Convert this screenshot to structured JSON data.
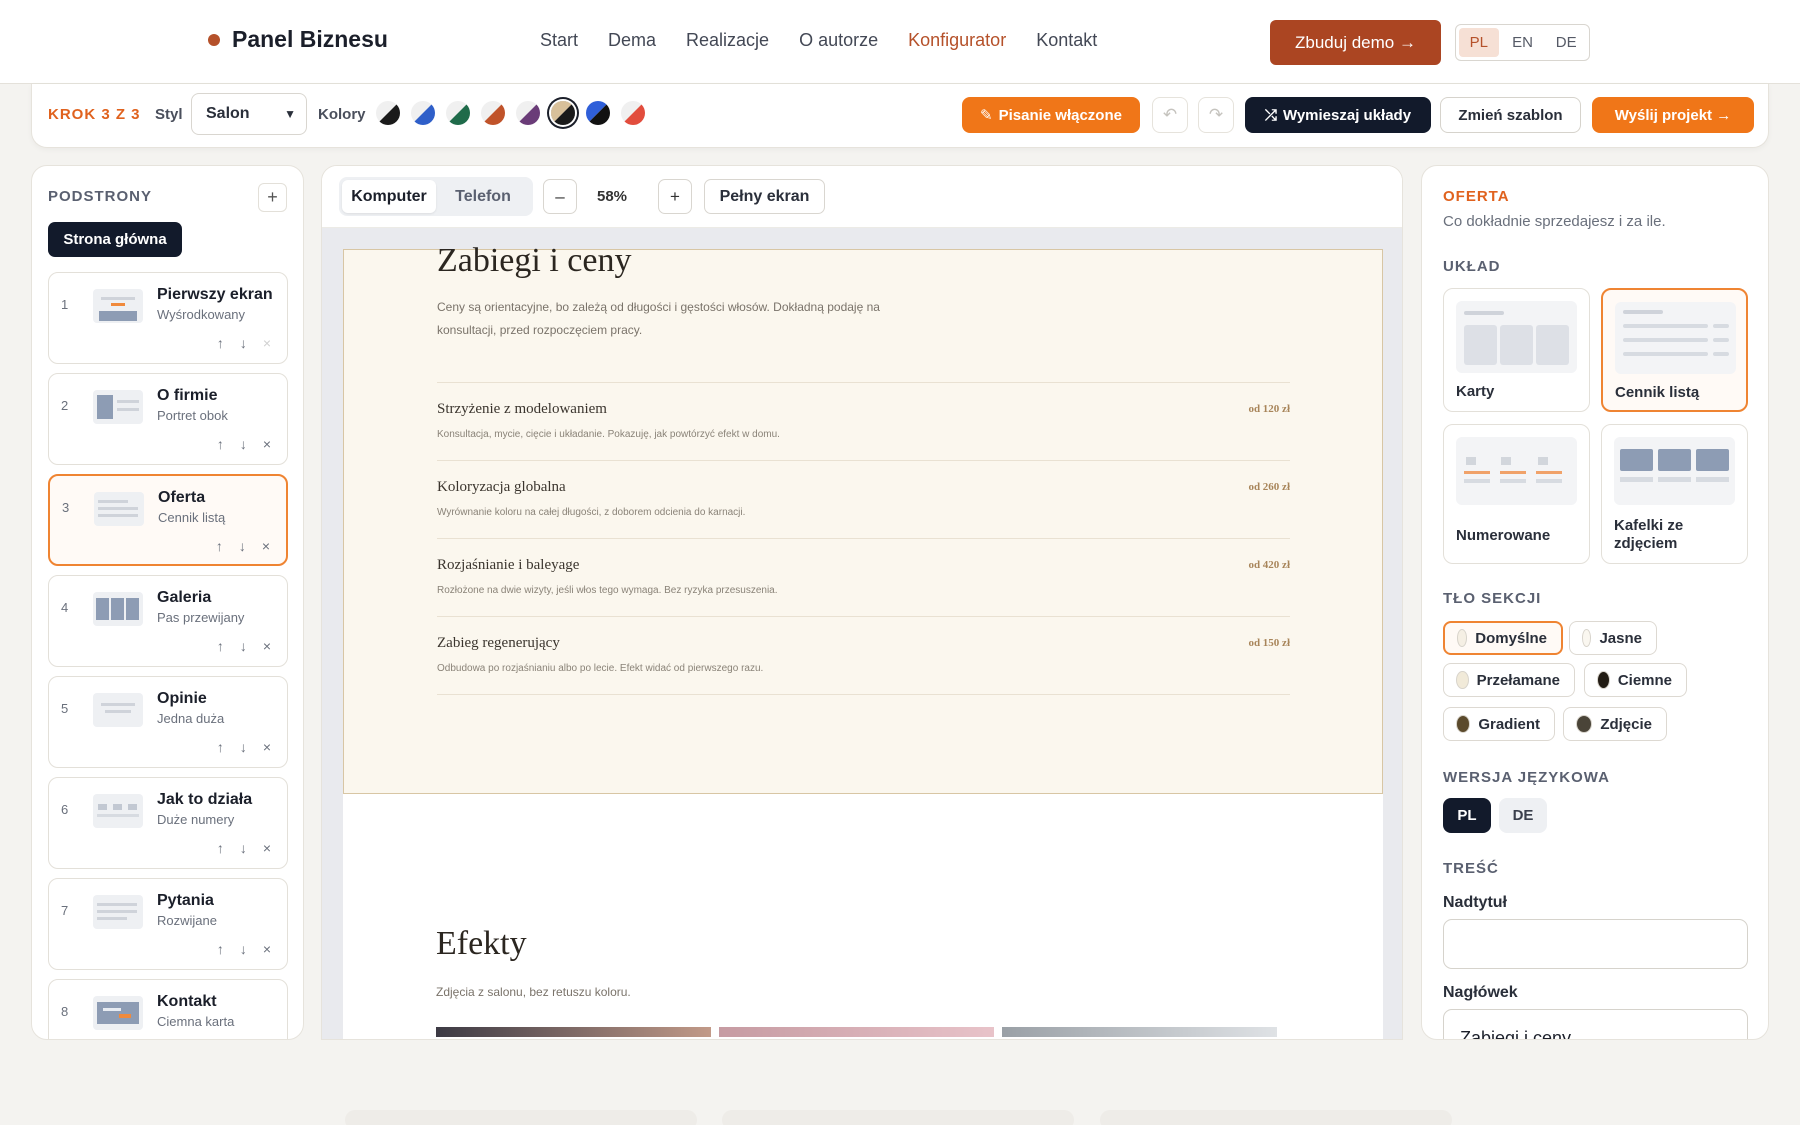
{
  "nav": {
    "brand": "Panel Biznesu",
    "links": [
      "Start",
      "Dema",
      "Realizacje",
      "O autorze",
      "Konfigurator",
      "Kontakt"
    ],
    "cta": "Zbuduj demo →",
    "langs": [
      "PL",
      "EN",
      "DE"
    ]
  },
  "toolbar": {
    "step": "KROK 3 Z 3",
    "style_label": "Styl",
    "style_value": "Salon",
    "colors_label": "Kolory",
    "swatches": [
      [
        "#f0f0f0",
        "#1a1a1a"
      ],
      [
        "#f0f0f0",
        "#2f5fc9"
      ],
      [
        "#f0f0f0",
        "#1f6b4a"
      ],
      [
        "#f0f0f0",
        "#c0532a"
      ],
      [
        "#f0f0f0",
        "#6a3c78"
      ],
      [
        "#d8c09a",
        "#1a1a1a"
      ],
      [
        "#2f5fd9",
        "#111111"
      ],
      [
        "#f0f0f0",
        "#e24d3d"
      ]
    ],
    "writing": "Pisanie włączone",
    "shuffle": "Wymieszaj układy",
    "change_template": "Zmień szablon",
    "send": "Wyślij projekt →"
  },
  "sidebar": {
    "title": "PODSTRONY",
    "home": "Strona główna",
    "pages": [
      {
        "n": "1",
        "name": "Pierwszy ekran",
        "sub": "Wyśrodkowany"
      },
      {
        "n": "2",
        "name": "O firmie",
        "sub": "Portret obok"
      },
      {
        "n": "3",
        "name": "Oferta",
        "sub": "Cennik listą"
      },
      {
        "n": "4",
        "name": "Galeria",
        "sub": "Pas przewijany"
      },
      {
        "n": "5",
        "name": "Opinie",
        "sub": "Jedna duża"
      },
      {
        "n": "6",
        "name": "Jak to działa",
        "sub": "Duże numery"
      },
      {
        "n": "7",
        "name": "Pytania",
        "sub": "Rozwijane"
      },
      {
        "n": "8",
        "name": "Kontakt",
        "sub": "Ciemna karta"
      }
    ],
    "actions": {
      "up": "↑",
      "down": "↓",
      "remove": "×"
    }
  },
  "preview": {
    "devices": [
      "Komputer",
      "Telefon"
    ],
    "zoom": "58%",
    "zoom_out": "–",
    "zoom_in": "+",
    "fullscreen": "Pełny ekran",
    "site": {
      "offer_title": "Zabiegi i ceny",
      "offer_intro": "Ceny są orientacyjne, bo zależą od długości i gęstości włosów. Dokładną podaję na konsultacji, przed rozpoczęciem pracy.",
      "items": [
        {
          "name": "Strzyżenie z modelowaniem",
          "desc": "Konsultacja, mycie, cięcie i układanie. Pokazuję, jak powtórzyć efekt w domu.",
          "price": "od 120 zł"
        },
        {
          "name": "Koloryzacja globalna",
          "desc": "Wyrównanie koloru na całej długości, z doborem odcienia do karnacji.",
          "price": "od 260 zł"
        },
        {
          "name": "Rozjaśnianie i baleyage",
          "desc": "Rozłożone na dwie wizyty, jeśli włos tego wymaga. Bez ryzyka przesuszenia.",
          "price": "od 420 zł"
        },
        {
          "name": "Zabieg regenerujący",
          "desc": "Odbudowa po rozjaśnianiu albo po lecie. Efekt widać od pierwszego razu.",
          "price": "od 150 zł"
        }
      ],
      "effects_title": "Efekty",
      "effects_intro": "Zdjęcia z salonu, bez retuszu koloru."
    }
  },
  "panel": {
    "section": "OFERTA",
    "section_sub": "Co dokładnie sprzedajesz i za ile.",
    "layout_heading": "UKŁAD",
    "layouts": [
      "Karty",
      "Cennik listą",
      "Numerowane",
      "Kafelki ze zdjęciem"
    ],
    "bg_heading": "TŁO SEKCJI",
    "bgs": [
      {
        "label": "Domyślne",
        "color": "#f5efe4"
      },
      {
        "label": "Jasne",
        "color": "#faf7f0"
      },
      {
        "label": "Przełamane",
        "color": "#f1ead9"
      },
      {
        "label": "Ciemne",
        "color": "#221c14"
      },
      {
        "label": "Gradient",
        "color": "#5b4a2c"
      },
      {
        "label": "Zdjęcie",
        "color": "#4a4438"
      }
    ],
    "lang_heading": "WERSJA JĘZYKOWA",
    "lang_versions": [
      "PL",
      "DE"
    ],
    "content_heading": "TREŚĆ",
    "overtitle_label": "Nadtytuł",
    "overtitle_value": "",
    "heading_label": "Nagłówek",
    "heading_value": "Zabiegi i ceny"
  }
}
